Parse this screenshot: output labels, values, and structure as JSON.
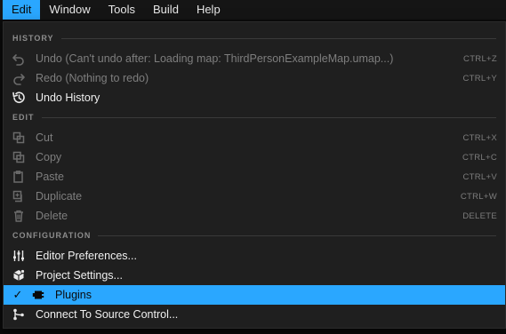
{
  "menubar": {
    "items": [
      {
        "label": "Edit",
        "active": true
      },
      {
        "label": "Window"
      },
      {
        "label": "Tools"
      },
      {
        "label": "Build"
      },
      {
        "label": "Help"
      }
    ]
  },
  "dropdown": {
    "sections": [
      {
        "header": "HISTORY",
        "items": [
          {
            "label": "Undo (Can't undo after: Loading map: ThirdPersonExampleMap.umap...)",
            "shortcut": "CTRL+Z",
            "icon": "undo-icon",
            "enabled": false
          },
          {
            "label": "Redo (Nothing to redo)",
            "shortcut": "CTRL+Y",
            "icon": "redo-icon",
            "enabled": false
          },
          {
            "label": "Undo History",
            "shortcut": "",
            "icon": "history-icon",
            "enabled": true
          }
        ]
      },
      {
        "header": "EDIT",
        "items": [
          {
            "label": "Cut",
            "shortcut": "CTRL+X",
            "icon": "cut-icon",
            "enabled": false
          },
          {
            "label": "Copy",
            "shortcut": "CTRL+C",
            "icon": "copy-icon",
            "enabled": false
          },
          {
            "label": "Paste",
            "shortcut": "CTRL+V",
            "icon": "paste-icon",
            "enabled": false
          },
          {
            "label": "Duplicate",
            "shortcut": "CTRL+W",
            "icon": "duplicate-icon",
            "enabled": false
          },
          {
            "label": "Delete",
            "shortcut": "DELETE",
            "icon": "trash-icon",
            "enabled": false
          }
        ]
      },
      {
        "header": "CONFIGURATION",
        "items": [
          {
            "label": "Editor Preferences...",
            "shortcut": "",
            "icon": "sliders-icon",
            "enabled": true
          },
          {
            "label": "Project Settings...",
            "shortcut": "",
            "icon": "settings-cube-icon",
            "enabled": true
          },
          {
            "label": "Plugins",
            "shortcut": "",
            "icon": "plugin-icon",
            "enabled": true,
            "checked": true,
            "highlighted": true
          },
          {
            "label": "Connect To Source Control...",
            "shortcut": "",
            "icon": "source-control-icon",
            "enabled": true
          }
        ]
      }
    ]
  },
  "colors": {
    "accent": "#2aa7ff",
    "menu_bg": "#1f1f1f",
    "menubar_bg": "#151515"
  }
}
